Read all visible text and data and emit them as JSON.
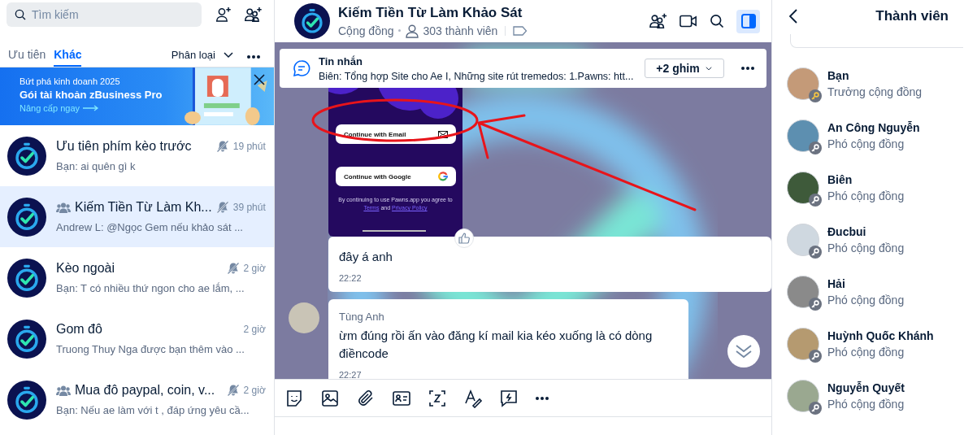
{
  "search": {
    "placeholder": "Tìm kiếm"
  },
  "tabs": [
    {
      "label": "Ưu tiên",
      "selected": false
    },
    {
      "label": "Khác",
      "selected": true
    }
  ],
  "filter": {
    "label": "Phân loại"
  },
  "promo": {
    "kicker": "Bứt phá kinh doanh 2025",
    "headline": "Gói tài khoản zBusiness Pro",
    "link": "Nâng cấp ngay"
  },
  "conversations": [
    {
      "name": "Ưu tiên phím kèo trước",
      "group": false,
      "muted": true,
      "time": "19 phút",
      "preview": "Bạn: ai quên gì k",
      "selected": false
    },
    {
      "name": "Kiếm Tiền Từ Làm Kh...",
      "group": true,
      "muted": true,
      "time": "39 phút",
      "preview": "Andrew L: @Ngọc Gem nếu khảo sát ...",
      "selected": true
    },
    {
      "name": "Kèo ngoài",
      "group": false,
      "muted": true,
      "time": "2 giờ",
      "preview": "Bạn: T có nhiều thứ ngon cho ae lắm, ...",
      "selected": false
    },
    {
      "name": "Gom đô",
      "group": false,
      "muted": false,
      "time": "2 giờ",
      "preview": "Truong Thuy Nga được bạn thêm vào ...",
      "selected": false
    },
    {
      "name": "Mua đô paypal, coin, v...",
      "group": true,
      "muted": true,
      "time": "2 giờ",
      "preview": "Bạn: Nếu ae làm với t , đáp ứng yêu cầ...",
      "selected": false
    }
  ],
  "chat": {
    "title": "Kiếm Tiền Từ Làm Khảo Sát",
    "type": "Cộng đồng",
    "members": "303 thành viên",
    "members_panel_open": true
  },
  "pinned": {
    "title": "Tin nhắn",
    "text": "Biên: Tổng hợp Site cho Ae I, Những site rút tremedos: 1.Pawns: htt...",
    "pins": "+2 ghim"
  },
  "messages": [
    {
      "kind": "image",
      "email_button": "Continue with Email",
      "google_button": "Continue with Google",
      "consent": "By continuing to use Pawns.app you agree to",
      "terms_link": "Terms",
      "consent_and": "and",
      "privacy_link": "Privacy Policy"
    },
    {
      "kind": "text",
      "text": "đây á anh",
      "time": "22:22"
    },
    {
      "kind": "text",
      "sender": "Tùng Anh",
      "text": "ừm đúng rồi ấn vào đăng kí mail kia kéo xuống là có dòng điềncode",
      "time": "22:27"
    }
  ],
  "members_panel": {
    "title": "Thành viên"
  },
  "members": [
    {
      "name": "Bạn",
      "role": "Trưởng cộng đồng",
      "kind": "owner"
    },
    {
      "name": "An Công Nguyễn",
      "role": "Phó cộng đồng",
      "kind": "deputy"
    },
    {
      "name": "Biên",
      "role": "Phó cộng đồng",
      "kind": "deputy"
    },
    {
      "name": "Đucbui",
      "role": "Phó cộng đồng",
      "kind": "deputy"
    },
    {
      "name": "Hải",
      "role": "Phó cộng đồng",
      "kind": "deputy"
    },
    {
      "name": "Huỳnh Quốc Khánh",
      "role": "Phó cộng đồng",
      "kind": "deputy"
    },
    {
      "name": "Nguyễn Quyết",
      "role": "Phó cộng đồng",
      "kind": "deputy"
    }
  ]
}
